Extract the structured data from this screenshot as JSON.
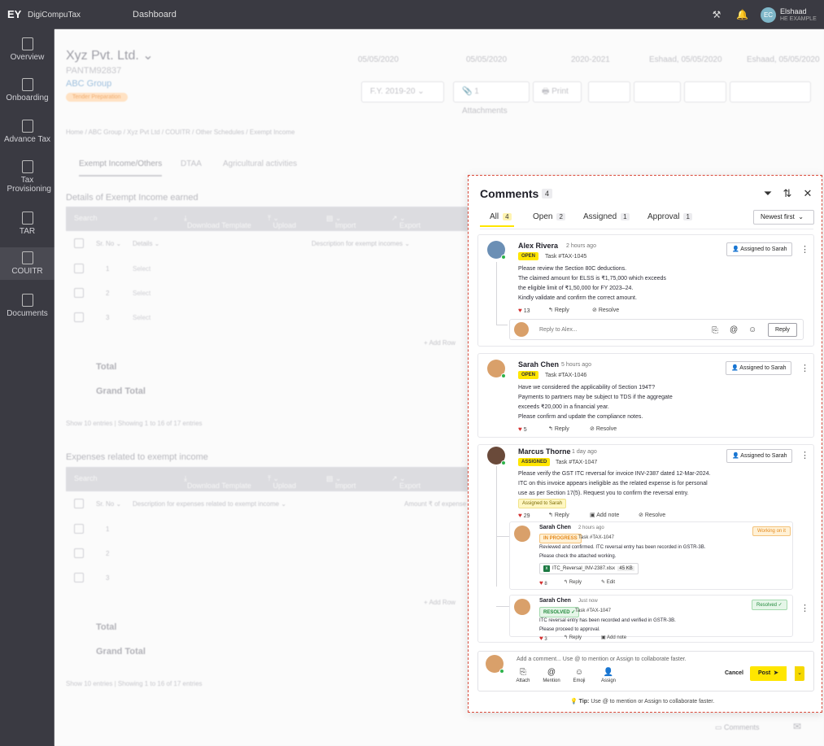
{
  "topbar": {
    "logo": "EY",
    "app_name": "DigiCompuTax",
    "page": "Dashboard",
    "user_initials": "EC",
    "user_name": "Elshaad",
    "user_role": "HE EXAMPLE"
  },
  "sidenav": [
    {
      "label": "Overview"
    },
    {
      "label": "Onboarding"
    },
    {
      "label": "Advance Tax"
    },
    {
      "label": "Tax Provisioning"
    },
    {
      "label": "TAR"
    },
    {
      "label": "COUITR"
    },
    {
      "label": "Documents"
    }
  ],
  "background": {
    "company": "Xyz Pvt. Ltd.",
    "pan": "PANTM92837",
    "group": "ABC Group",
    "status": "Tender Preparation",
    "meta": [
      "05/05/2020",
      "05/05/2020",
      "2020-2021",
      "Eshaad, 05/05/2020",
      "Eshaad, 05/05/2020"
    ],
    "fy": "F.Y. 2019-20",
    "attachments": "Attachments",
    "print": "Print",
    "breadcrumb": "Home  /  ABC Group  /  Xyz Pvt Ltd  /  COUITR  /  Other Schedules  /  Exempt Income",
    "tabs": [
      "Exempt Income/Others",
      "DTAA",
      "Agricultural activities"
    ],
    "section1": "Details of Exempt Income earned",
    "section2": "Expenses related to exempt income",
    "toolbar": {
      "search": "Search",
      "download": "Download Template",
      "upload": "Upload",
      "import": "Import",
      "export": "Export"
    },
    "col_srno": "Sr. No",
    "col_details": "Details",
    "col_desc": "Description for exempt incomes",
    "col_desc2": "Description for expenses related to exempt income",
    "col_amount": "Amount ₹ of expense",
    "select": "Select",
    "add_row": "+ Add Row",
    "total": "Total",
    "grand_total": "Grand Total",
    "footer1": "Show   10   entries   |   Showing 1 to 16 of 17 entries",
    "footer2": "Show   10   entries   |   Showing 1 to 16 of 17 entries",
    "bottom_comments": "Comments"
  },
  "panel": {
    "title": "Comments",
    "count": "4",
    "tabs": [
      {
        "label": "All",
        "count": "4"
      },
      {
        "label": "Open",
        "count": "2"
      },
      {
        "label": "Assigned",
        "count": "1"
      },
      {
        "label": "Approval",
        "count": "1"
      }
    ],
    "sort": "Newest first",
    "comments": [
      {
        "name": "Alex Rivera",
        "time": "2 hours ago",
        "status": "OPEN",
        "task": "Task #TAX-1045",
        "assign": "Assigned to Sarah",
        "lines": [
          "Please review the Section 80C deductions.",
          "The claimed amount for ELSS is ₹1,75,000 which exceeds",
          "the eligible limit of ₹1,50,000 for FY 2023–24.",
          "Kindly validate and confirm the correct amount."
        ],
        "likes": "13",
        "reply": "Reply",
        "resolve": "Resolve",
        "reply_placeholder": "Reply to Alex...",
        "reply_btn": "Reply"
      },
      {
        "name": "Sarah Chen",
        "time": "5 hours ago",
        "status": "OPEN",
        "task": "Task #TAX-1046",
        "assign": "Assigned to Sarah",
        "lines": [
          "Have we considered the applicability of Section 194T?",
          "Payments to partners may be subject to TDS if the aggregate",
          "exceeds ₹20,000 in a financial year.",
          "Please confirm and update the compliance notes."
        ],
        "likes": "5",
        "reply": "Reply",
        "resolve": "Resolve"
      },
      {
        "name": "Marcus Thorne",
        "time": "1 day ago",
        "status": "ASSIGNED",
        "task": "Task #TAX-1047",
        "assign": "Assigned to Sarah",
        "lines": [
          "Please verify the GST ITC reversal for invoice INV-2387 dated 12-Mar-2024.",
          "ITC on this invoice appears ineligible as the related expense is for personal",
          "use as per Section 17(5). Request you to confirm the reversal entry."
        ],
        "tag": "Assigned to Sarah",
        "likes": "29",
        "reply": "Reply",
        "add_note": "Add note",
        "resolve": "Resolve"
      }
    ],
    "replies": [
      {
        "name": "Sarah Chen",
        "time": "2 hours ago",
        "status": "IN PROGRESS",
        "task": "Task #TAX-1047",
        "badge": "Working on it",
        "lines": [
          "Reviewed and confirmed. ITC reversal entry has been recorded in GSTR-3B.",
          "Please check the attached working."
        ],
        "file": "ITC_Reversal_INV-2387.xlsx",
        "file_size": "45 KB",
        "likes": "8",
        "reply": "Reply",
        "edit": "Edit"
      },
      {
        "name": "Sarah Chen",
        "time": "Just now",
        "status": "RESOLVED",
        "task": "Task #TAX-1047",
        "badge": "Resolved",
        "lines": [
          "ITC reversal entry has been recorded and verified in GSTR-3B.",
          "Please proceed to approval."
        ],
        "likes": "3",
        "reply": "Reply",
        "add_note": "Add note"
      }
    ],
    "composer": {
      "placeholder": "Add a comment... Use @ to mention or Assign to collaborate faster.",
      "tools": [
        "Attach",
        "Mention",
        "Emoji",
        "Assign"
      ],
      "cancel": "Cancel",
      "post": "Post"
    },
    "tip": "Tip: Use @ to mention or Assign to collaborate faster.",
    "tip_label": "Tip:"
  }
}
